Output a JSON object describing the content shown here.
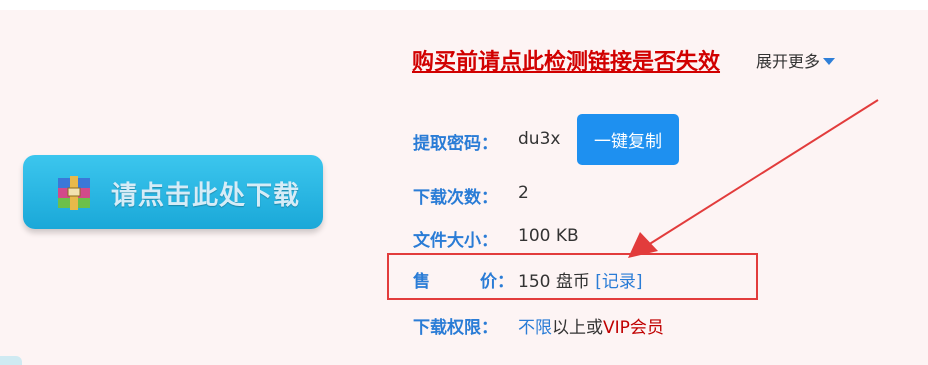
{
  "download_button": {
    "label": "请点击此处下载",
    "icon": "archive-icon"
  },
  "check_link": "购买前请点此检测链接是否失效",
  "expand_more": "展开更多",
  "details": {
    "password": {
      "label": "提取密码：",
      "value": "du3x"
    },
    "copy_button": "一键复制",
    "download_count": {
      "label": "下载次数：",
      "value": "2"
    },
    "file_size": {
      "label": "文件大小：",
      "value": "100 KB"
    },
    "price": {
      "label_char1": "售",
      "label_char2": "价：",
      "value": "150 盘币",
      "record_link": "[记录]"
    },
    "permission": {
      "label": "下载权限：",
      "part1": "不限",
      "part2": "以上或",
      "part3": "VIP会员"
    }
  },
  "colors": {
    "accent_blue": "#2a7cd6",
    "link_red": "#d10000",
    "button_blue": "#1e90f0",
    "highlight_red": "#e23c3c",
    "panel_bg": "#fdf4f4"
  }
}
